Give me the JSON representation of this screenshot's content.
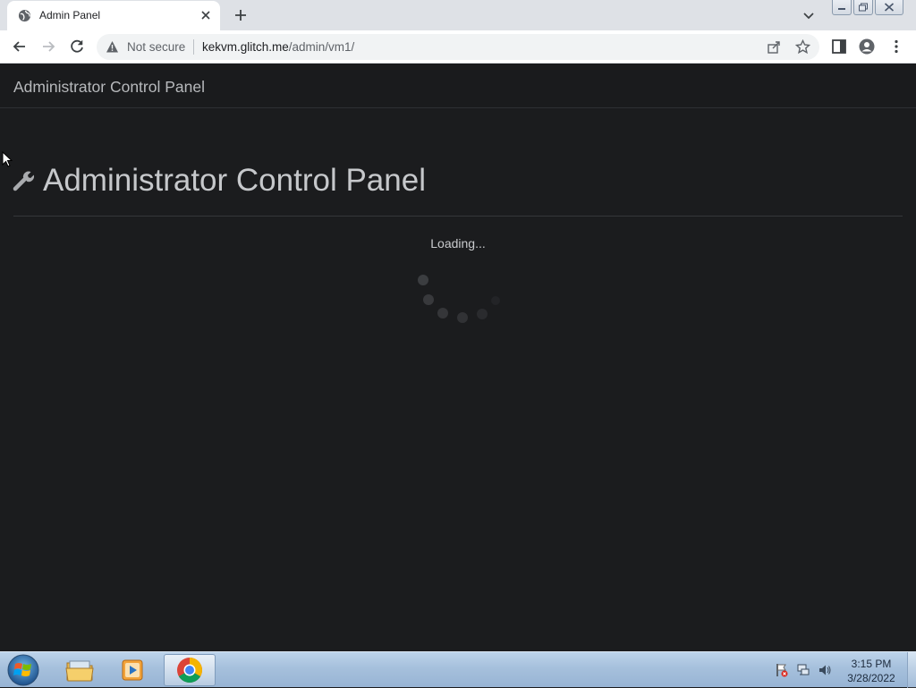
{
  "browser": {
    "tab": {
      "title": "Admin Panel"
    },
    "address_bar": {
      "security_label": "Not secure",
      "host": "kekvm.glitch.me",
      "path": "/admin/vm1/"
    }
  },
  "page": {
    "navbar_brand": "Administrator Control Panel",
    "heading": "Administrator Control Panel",
    "heading_icon": "wrench-icon",
    "loading_text": "Loading..."
  },
  "taskbar": {
    "apps": [
      "windows-explorer",
      "media-player",
      "google-chrome"
    ],
    "active_app": "google-chrome",
    "clock": {
      "time": "3:15 PM",
      "date": "3/28/2022"
    }
  },
  "colors": {
    "page_background": "#1b1c1e",
    "heading_text": "#c6c8cb",
    "tab_strip": "#dee1e6"
  }
}
